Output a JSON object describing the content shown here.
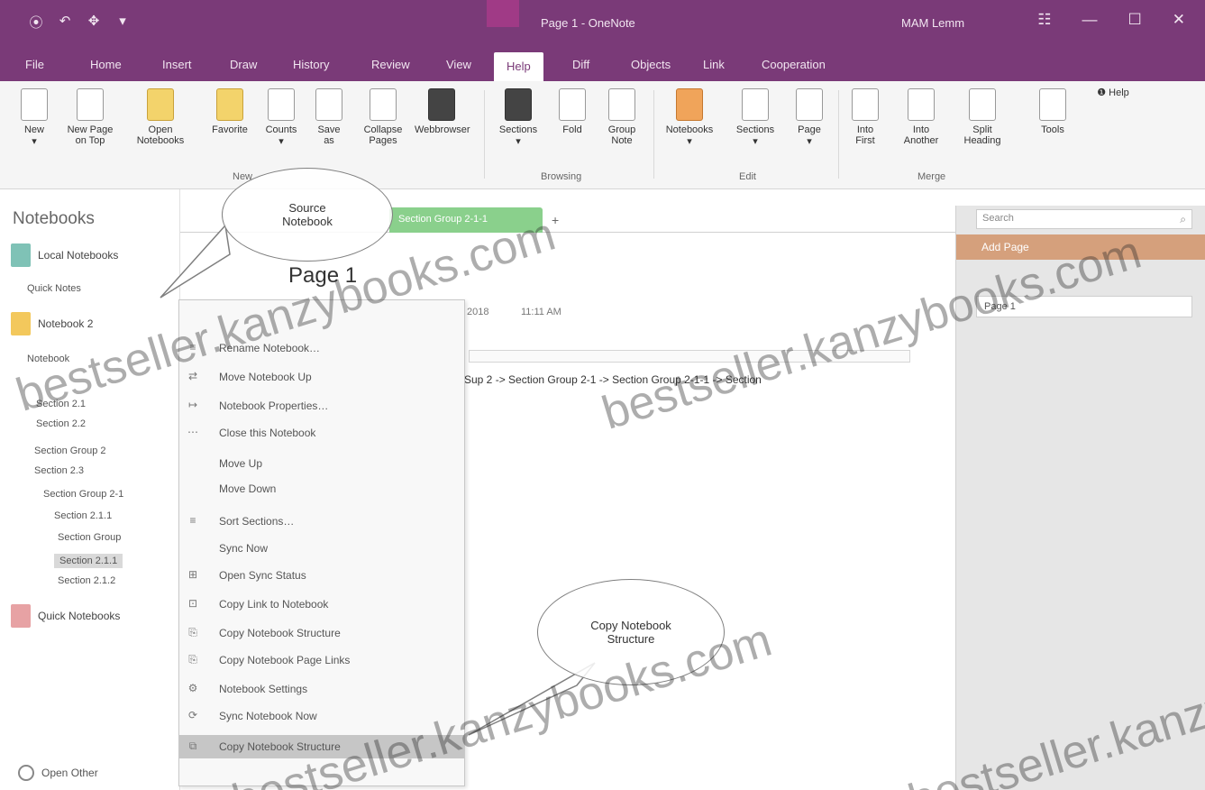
{
  "titlebar": {
    "qat": [
      "⦿",
      "↶",
      "✥",
      "▾"
    ],
    "doc_title": "Page 1 - OneNote",
    "user": "MAM Lemm",
    "controls": [
      "☷",
      "—",
      "☐",
      "✕"
    ]
  },
  "tabs": [
    "File",
    "Home",
    "Insert",
    "Draw",
    "History",
    "Review",
    "View",
    "Help",
    "Diff",
    "Objects",
    "Link",
    "Cooperation"
  ],
  "active_tab_index": 7,
  "ribbon": {
    "buttons": [
      {
        "label": "New",
        "sub": "▾"
      },
      {
        "label": "New Page",
        "sub": "on Top"
      },
      {
        "label": "Open",
        "sub": "Notebooks"
      },
      {
        "label": "Favorite",
        "sub": ""
      },
      {
        "label": "Counts",
        "sub": "▾"
      },
      {
        "label": "Save",
        "sub": "as"
      },
      {
        "label": "Collapse",
        "sub": "Pages"
      },
      {
        "label": "Webbrowser",
        "sub": ""
      },
      {
        "label": "Sections",
        "sub": "▾"
      },
      {
        "label": "Fold",
        "sub": ""
      },
      {
        "label": "Group",
        "sub": "Note"
      },
      {
        "label": "Notebooks",
        "sub": "▾"
      },
      {
        "label": "Sections",
        "sub": "▾"
      },
      {
        "label": "Page",
        "sub": "▾"
      },
      {
        "label": "Into",
        "sub": "First"
      },
      {
        "label": "Into",
        "sub": "Another"
      },
      {
        "label": "Split",
        "sub": "Heading"
      },
      {
        "label": "Tools",
        "sub": ""
      }
    ],
    "groups": [
      "New",
      "Browsing",
      "Edit",
      "Merge"
    ],
    "help_label": "Help"
  },
  "notebooks": {
    "header": "Notebooks",
    "items": [
      {
        "name": "Local Notebooks",
        "color": "#7fc2b6"
      },
      {
        "name": "Notebook 2",
        "color": "#f3c85c"
      },
      {
        "name": "Quick Notebooks",
        "color": "#e7a2a4"
      }
    ],
    "sections": [
      "Quick Notes",
      "Notebook",
      "Section 2.1",
      "Section 2.2",
      "Section Group 2",
      "Section 2.3",
      "Section Group 2-1",
      "Section 2.1.1",
      "Section Group",
      "Section 2.1.1",
      "Section 2.1.2"
    ],
    "open_other": "Open Other"
  },
  "context_menu": {
    "items": [
      {
        "icon": "≡",
        "label": "Rename Notebook…"
      },
      {
        "icon": "⇄",
        "label": "Move Notebook Up"
      },
      {
        "icon": "↦",
        "label": "Notebook Properties…"
      },
      {
        "icon": "⋯",
        "label": "Close this Notebook"
      },
      {
        "icon": "",
        "label": "Move Up"
      },
      {
        "icon": "",
        "label": "Move Down"
      },
      {
        "icon": "≡",
        "label": "Sort Sections…"
      },
      {
        "icon": "",
        "label": "Sync Now"
      },
      {
        "icon": "⊞",
        "label": "Open Sync Status"
      },
      {
        "icon": "⊡",
        "label": "Copy Link to Notebook"
      },
      {
        "icon": "⎘",
        "label": "Copy Notebook Structure"
      },
      {
        "icon": "⎘",
        "label": "Copy Notebook Page Links"
      },
      {
        "icon": "⚙",
        "label": "Notebook Settings"
      },
      {
        "icon": "⟳",
        "label": "Sync Notebook Now"
      },
      {
        "icon": "⧉",
        "label": "Copy Notebook Structure"
      }
    ],
    "highlight_index": 14
  },
  "section_tab": "Section Group 2-1-1",
  "add_tab": "+",
  "page": {
    "title": "Page 1",
    "date": "2018",
    "time": "11:11 AM",
    "content": "Sup 2 -> Section Group 2-1 -> Section Group 2-1-1 -> Section"
  },
  "page_pane": {
    "search_placeholder": "Search",
    "search_icon": "⌕",
    "add_page": "Add Page",
    "page_entry": "Page 1"
  },
  "callouts": {
    "top": "Source Notebook",
    "bottom": "Copy Notebook Structure"
  },
  "watermark": "bestseller.kanzybooks.com",
  "colors": {
    "onenote_purple": "#7a3a78",
    "section_green": "#8ad08c",
    "add_page_bar": "#d5a07c"
  }
}
